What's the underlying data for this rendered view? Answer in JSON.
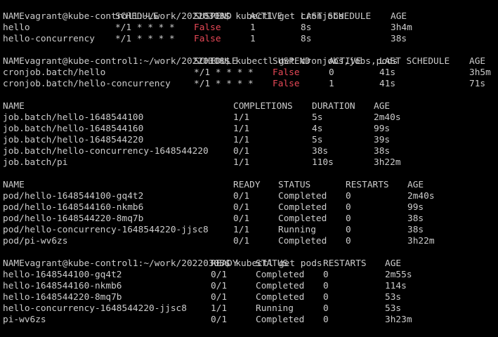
{
  "colors": {
    "background": "#000000",
    "foreground": "#cccccc",
    "false_value": "#e74856"
  },
  "prompt": "vagrant@kube-control1:~/work/20220308$",
  "commands": [
    "kubectl get cronjobs",
    "kubectl get cronjobs,jobs,pods",
    "kubectl get pods"
  ],
  "cronjobs1": {
    "headers": [
      "NAME",
      "SCHEDULE",
      "SUSPEND",
      "ACTIVE",
      "LAST SCHEDULE",
      "AGE"
    ],
    "rows": [
      [
        "hello",
        "*/1 * * * *",
        "False",
        "1",
        "8s",
        "3h4m"
      ],
      [
        "hello-concurrency",
        "*/1 * * * *",
        "False",
        "1",
        "8s",
        "38s"
      ]
    ]
  },
  "cronjobs2": {
    "headers": [
      "NAME",
      "SCHEDULE",
      "SUSPEND",
      "ACTIVE",
      "LAST SCHEDULE",
      "AGE"
    ],
    "rows": [
      [
        "cronjob.batch/hello",
        "*/1 * * * *",
        "False",
        "0",
        "41s",
        "3h5m"
      ],
      [
        "cronjob.batch/hello-concurrency",
        "*/1 * * * *",
        "False",
        "1",
        "41s",
        "71s"
      ]
    ]
  },
  "jobs": {
    "headers": [
      "NAME",
      "COMPLETIONS",
      "DURATION",
      "AGE"
    ],
    "rows": [
      [
        "job.batch/hello-1648544100",
        "1/1",
        "5s",
        "2m40s"
      ],
      [
        "job.batch/hello-1648544160",
        "1/1",
        "4s",
        "99s"
      ],
      [
        "job.batch/hello-1648544220",
        "1/1",
        "5s",
        "39s"
      ],
      [
        "job.batch/hello-concurrency-1648544220",
        "0/1",
        "38s",
        "38s"
      ],
      [
        "job.batch/pi",
        "1/1",
        "110s",
        "3h22m"
      ]
    ]
  },
  "pods1": {
    "headers": [
      "NAME",
      "READY",
      "STATUS",
      "RESTARTS",
      "AGE"
    ],
    "rows": [
      [
        "pod/hello-1648544100-gq4t2",
        "0/1",
        "Completed",
        "0",
        "2m40s"
      ],
      [
        "pod/hello-1648544160-nkmb6",
        "0/1",
        "Completed",
        "0",
        "99s"
      ],
      [
        "pod/hello-1648544220-8mq7b",
        "0/1",
        "Completed",
        "0",
        "38s"
      ],
      [
        "pod/hello-concurrency-1648544220-jjsc8",
        "1/1",
        "Running",
        "0",
        "38s"
      ],
      [
        "pod/pi-wv6zs",
        "0/1",
        "Completed",
        "0",
        "3h22m"
      ]
    ]
  },
  "pods2": {
    "headers": [
      "NAME",
      "READY",
      "STATUS",
      "RESTARTS",
      "AGE"
    ],
    "rows": [
      [
        "hello-1648544100-gq4t2",
        "0/1",
        "Completed",
        "0",
        "2m55s"
      ],
      [
        "hello-1648544160-nkmb6",
        "0/1",
        "Completed",
        "0",
        "114s"
      ],
      [
        "hello-1648544220-8mq7b",
        "0/1",
        "Completed",
        "0",
        "53s"
      ],
      [
        "hello-concurrency-1648544220-jjsc8",
        "1/1",
        "Running",
        "0",
        "53s"
      ],
      [
        "pi-wv6zs",
        "0/1",
        "Completed",
        "0",
        "3h23m"
      ]
    ]
  }
}
